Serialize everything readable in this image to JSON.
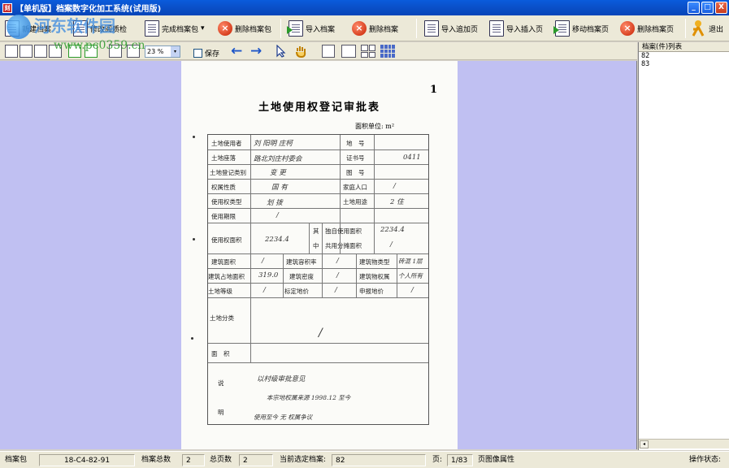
{
  "window": {
    "app_icon_text": "刻",
    "title": "【单机版】档案数字化加工系统(试用版)",
    "controls": {
      "minimize": "_",
      "maximize": "□",
      "close": "X"
    }
  },
  "toolbar": {
    "new_archive": "新建档案",
    "quality_check": "修改阅质检",
    "complete_package": "完成档案包",
    "delete_package": "删除档案包",
    "import_archive": "导入档案",
    "delete_archive": "删除档案",
    "import_append_page": "导入追加页",
    "import_insert_page": "导入插入页",
    "move_archive_page": "移动档案页",
    "delete_archive_page": "删除档案页",
    "exit": "退出",
    "dropdown_glyph": "▾"
  },
  "watermark": {
    "text": "河东软件园",
    "url": "www.pc0359.cn"
  },
  "toolbar2": {
    "zoom_value": "23 %",
    "save_label": "保存",
    "undo": "←",
    "redo": "→"
  },
  "document": {
    "page_number": "1",
    "title": "土地使用权登记审批表",
    "area_unit": "面积单位:  m²",
    "fields": {
      "land_user": "土地使用者",
      "land_location": "土地座落",
      "register_type": "土地登记类别",
      "right_nature": "权属性质",
      "right_type": "使用权类型",
      "term": "使用期限",
      "right_area": "使用权面积",
      "parcel_no": "地　号",
      "cert_no": "证书号",
      "map_no": "图　号",
      "household_pop": "家庭人口",
      "land_use": "土地用途",
      "of_which": "其",
      "middle": "中",
      "exclusive_area": "独自使用面积",
      "shared_area": "共用分摊面积",
      "building_area": "建筑面积",
      "plot_ratio": "建筑容积率",
      "building_type": "建筑物类型",
      "building_footprint": "建筑占地面积",
      "building_density": "建筑密度",
      "building_ownership": "建筑物权属",
      "land_grade": "土地等级",
      "standard_price": "标定地价",
      "declared_price": "申报地价",
      "land_division": "土地分类",
      "area": "面　积",
      "remarks_1": "说",
      "remarks_2": "明"
    },
    "handwritten": {
      "land_user": "刘 阳明 庄柯",
      "land_location": "路北刘庄村委会",
      "cert_no": "0411",
      "register_type": "变 更",
      "right_nature": "国 有",
      "right_type": "划 拨",
      "land_use": "2  住",
      "household_pop": "/",
      "term": "/",
      "right_area": "2234.4",
      "exclusive_area": "2234.4",
      "shared_area": "/",
      "building_area": "/",
      "plot_ratio": "/",
      "building_type": "砖混 1层",
      "building_footprint": "319.0",
      "building_density": "/",
      "building_ownership": "个人所有",
      "land_grade": "/",
      "standard_price": "/",
      "declared_price": "/",
      "area_slash": "/",
      "remarks_line1": "以村级审批意见",
      "remarks_line2": "本宗地权属来源 1998.12 至今",
      "remarks_line3": "使用至今 无 权属争议"
    }
  },
  "right_panel": {
    "header": "档案(件)列表",
    "items": [
      "82",
      "83"
    ],
    "scroll_left": "◂"
  },
  "statusbar": {
    "package_label": "档案包",
    "package_value": "18-C4-82-91",
    "total_archives_label": "档案总数",
    "total_archives_value": "2",
    "total_pages_label": "总页数",
    "total_pages_value": "2",
    "current_archive_label": "当前选定档案:",
    "current_archive_value": "82",
    "page_label": "页:",
    "page_value": "1/83",
    "image_props_label": "页图像属性",
    "op_status_label": "操作状态:"
  },
  "colors": {
    "title_bar": "#0a4fc8",
    "viewer_bg": "#c0c0f2",
    "toolbar_bg": "#ece9d8"
  }
}
